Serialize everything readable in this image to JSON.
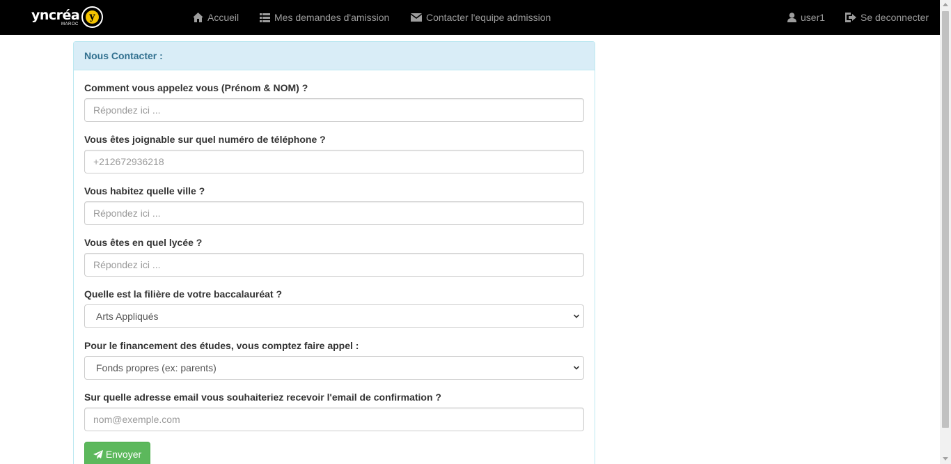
{
  "brand": {
    "name": "yncréa",
    "sub": "MAROC",
    "mark": "y"
  },
  "nav": {
    "home": "Accueil",
    "requests": "Mes demandes d'amission",
    "contact": "Contacter l'equipe admission",
    "user": "user1",
    "logout": "Se deconnecter"
  },
  "panel": {
    "title": "Nous Contacter :"
  },
  "form": {
    "name": {
      "label": "Comment vous appelez vous (Prénom & NOM) ?",
      "placeholder": "Répondez ici ...",
      "value": ""
    },
    "phone": {
      "label": "Vous êtes joignable sur quel numéro de téléphone ?",
      "placeholder": "+212672936218",
      "value": ""
    },
    "city": {
      "label": "Vous habitez quelle ville ?",
      "placeholder": "Répondez ici ...",
      "value": ""
    },
    "school": {
      "label": "Vous êtes en quel lycée ?",
      "placeholder": "Répondez ici ...",
      "value": ""
    },
    "bac": {
      "label": "Quelle est la filière de votre baccalauréat ?",
      "selected": "Arts Appliqués"
    },
    "funding": {
      "label": "Pour le financement des études, vous comptez faire appel :",
      "selected": "Fonds propres (ex: parents)"
    },
    "email": {
      "label": "Sur quelle adresse email vous souhaiteriez recevoir l'email de confirmation ?",
      "placeholder": "nom@exemple.com",
      "value": ""
    },
    "submit": "Envoyer"
  }
}
